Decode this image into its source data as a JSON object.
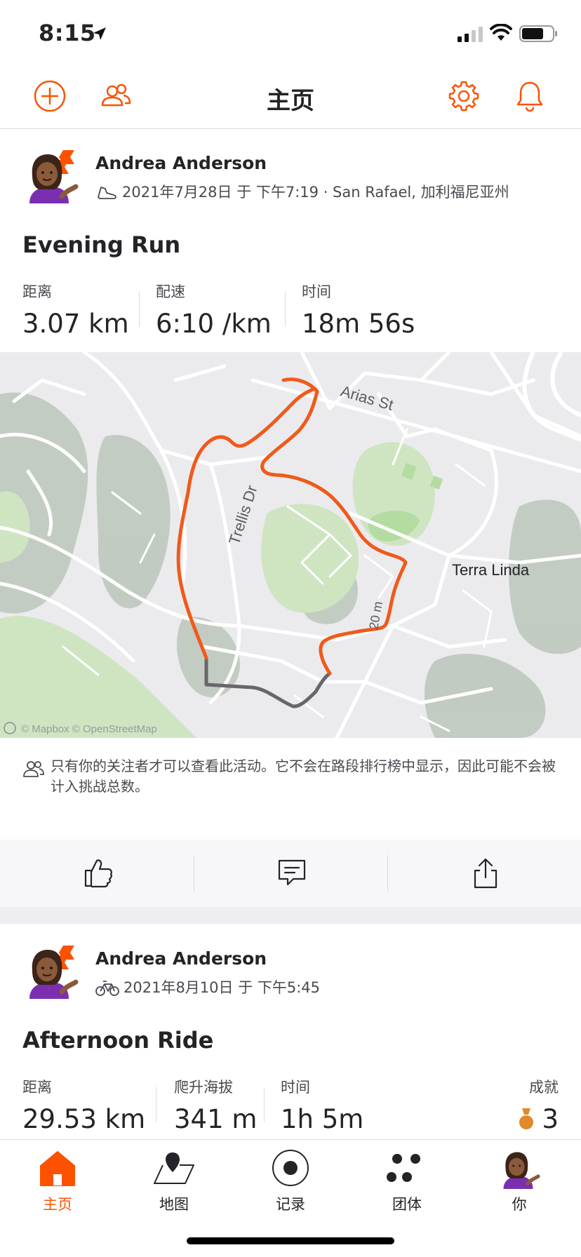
{
  "status_bar": {
    "time": "8:15",
    "icons": [
      "location-arrow-icon",
      "signal-icon",
      "wifi-icon",
      "battery-icon"
    ]
  },
  "header": {
    "title": "主页",
    "left_icons": [
      "add-circle-icon",
      "people-icon"
    ],
    "right_icons": [
      "gear-icon",
      "bell-icon"
    ]
  },
  "colors": {
    "accent": "#fc5200",
    "text": "#242428",
    "secondary": "#494950",
    "divider": "#dcdcdf",
    "route": "#f05a1a"
  },
  "feed": [
    {
      "athlete": "Andrea Anderson",
      "sport_icon": "shoe-icon",
      "meta": "2021年7月28日 于 下午7:19 · San Rafael, 加利福尼亚州",
      "title": "Evening Run",
      "stats": [
        {
          "label": "距离",
          "value": "3.07 km"
        },
        {
          "label": "配速",
          "value": "6:10 /km"
        },
        {
          "label": "时间",
          "value": "18m 56s"
        }
      ],
      "map": {
        "labels": {
          "street1": "Arias St",
          "street2": "Trellis Dr",
          "place": "Terra Linda",
          "elev": "20 m"
        },
        "attribution": "© Mapbox © OpenStreetMap"
      },
      "privacy_note": "只有你的关注者才可以查看此活动。它不会在路段排行榜中显示，因此可能不会被计入挑战总数。",
      "actions": [
        "thumbs-up-icon",
        "comment-icon",
        "share-icon"
      ]
    },
    {
      "athlete": "Andrea Anderson",
      "sport_icon": "bike-icon",
      "meta": "2021年8月10日 于 下午5:45",
      "title": "Afternoon Ride",
      "stats": [
        {
          "label": "距离",
          "value": "29.53 km"
        },
        {
          "label": "爬升海拔",
          "value": "341 m"
        },
        {
          "label": "时间",
          "value": "1h 5m"
        }
      ],
      "achievements": {
        "label": "成就",
        "value": "3",
        "icon": "medal-icon"
      }
    }
  ],
  "tabbar": [
    {
      "label": "主页",
      "icon": "home-icon",
      "active": true
    },
    {
      "label": "地图",
      "icon": "map-icon",
      "active": false
    },
    {
      "label": "记录",
      "icon": "record-icon",
      "active": false
    },
    {
      "label": "团体",
      "icon": "groups-icon",
      "active": false
    },
    {
      "label": "你",
      "icon": "profile-avatar-icon",
      "active": false
    }
  ]
}
